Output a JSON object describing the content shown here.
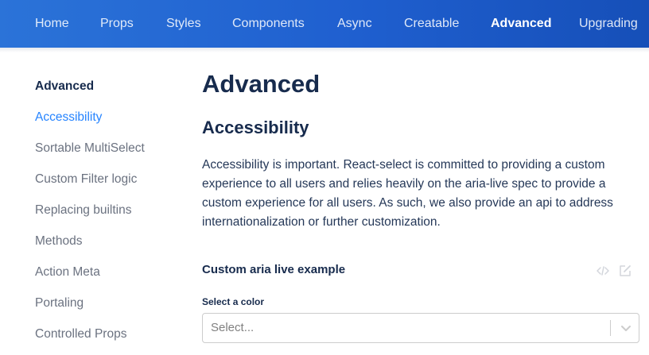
{
  "nav": {
    "items": [
      {
        "label": "Home",
        "active": false
      },
      {
        "label": "Props",
        "active": false
      },
      {
        "label": "Styles",
        "active": false
      },
      {
        "label": "Components",
        "active": false
      },
      {
        "label": "Async",
        "active": false
      },
      {
        "label": "Creatable",
        "active": false
      },
      {
        "label": "Advanced",
        "active": true
      },
      {
        "label": "Upgrading",
        "active": false
      }
    ]
  },
  "sidebar": {
    "items": [
      {
        "label": "Advanced"
      },
      {
        "label": "Accessibility"
      },
      {
        "label": "Sortable MultiSelect"
      },
      {
        "label": "Custom Filter logic"
      },
      {
        "label": "Replacing builtins"
      },
      {
        "label": "Methods"
      },
      {
        "label": "Action Meta"
      },
      {
        "label": "Portaling"
      },
      {
        "label": "Controlled Props"
      }
    ]
  },
  "main": {
    "title": "Advanced",
    "section_title": "Accessibility",
    "paragraph": "Accessibility is important. React-select is committed to providing a custom experience to all users and relies heavily on the aria-live spec to provide a custom experience for all users. As such, we also provide an api to address internationalization or further customization.",
    "example_title": "Custom aria live example",
    "field_label": "Select a color",
    "select_placeholder": "Select..."
  },
  "colors": {
    "nav_gradient_start": "#2b73d8",
    "nav_gradient_end": "#164fb8",
    "accent": "#2684ff",
    "heading": "#172b4d",
    "muted": "#6b7280"
  },
  "icons": {
    "example_code": "code-icon",
    "example_edit": "edit-icon",
    "select_indicator": "chevron-down-icon"
  }
}
